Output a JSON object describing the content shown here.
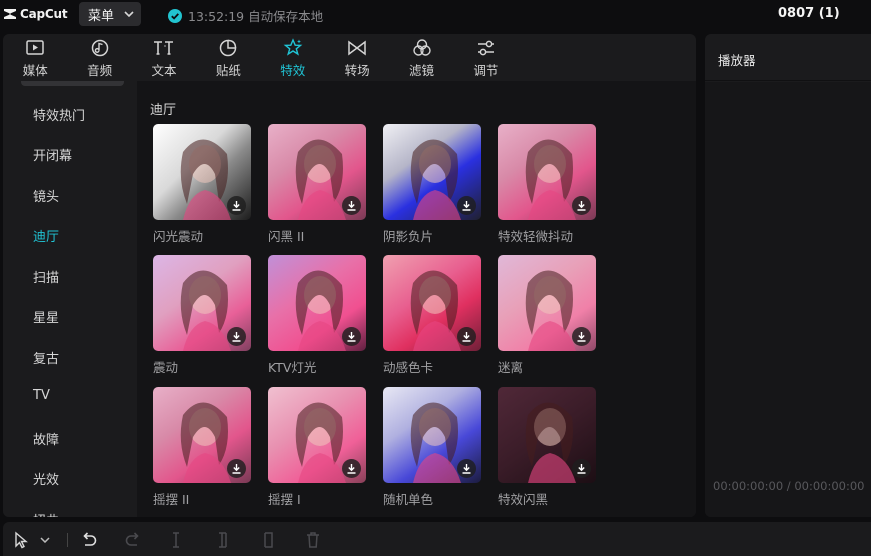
{
  "app": {
    "logo_text": "CapCut",
    "brand_color": "#20c4d5"
  },
  "header": {
    "menu_label": "菜单",
    "autosave_text": "13:52:19 自动保存本地",
    "project_title": "0807 (1)"
  },
  "tabs": [
    {
      "label": "媒体",
      "icon": "media-icon"
    },
    {
      "label": "音频",
      "icon": "audio-icon"
    },
    {
      "label": "文本",
      "icon": "text-icon"
    },
    {
      "label": "贴纸",
      "icon": "sticker-icon"
    },
    {
      "label": "特效",
      "icon": "effects-icon",
      "active": true
    },
    {
      "label": "转场",
      "icon": "transition-icon"
    },
    {
      "label": "滤镜",
      "icon": "filter-icon"
    },
    {
      "label": "调节",
      "icon": "adjust-icon"
    }
  ],
  "sidebar": {
    "items": [
      {
        "label": "特效热门"
      },
      {
        "label": "开闭幕"
      },
      {
        "label": "镜头"
      },
      {
        "label": "迪厅",
        "active": true
      },
      {
        "label": "扫描"
      },
      {
        "label": "星星"
      },
      {
        "label": "复古"
      },
      {
        "label": "TV"
      },
      {
        "label": "故障"
      },
      {
        "label": "光效"
      },
      {
        "label": "扭曲"
      }
    ]
  },
  "content": {
    "section_title": "迪厅",
    "effects": [
      {
        "label": "闪光震动",
        "style": "bw-flash"
      },
      {
        "label": "闪黑 II",
        "style": "pink"
      },
      {
        "label": "阴影负片",
        "style": "blue-neg"
      },
      {
        "label": "特效轻微抖动",
        "style": "pink"
      },
      {
        "label": "震动",
        "style": "pink-soft"
      },
      {
        "label": "KTV灯光",
        "style": "pink-lights"
      },
      {
        "label": "动感色卡",
        "style": "pink-red"
      },
      {
        "label": "迷离",
        "style": "pink-blur"
      },
      {
        "label": "摇摆 II",
        "style": "pink"
      },
      {
        "label": "摇摆 I",
        "style": "pink-motion"
      },
      {
        "label": "随机单色",
        "style": "blue-mono"
      },
      {
        "label": "特效闪黑",
        "style": "dark"
      }
    ]
  },
  "player": {
    "title": "播放器",
    "timecode": "00:00:00:00 / 00:00:00:00"
  },
  "toolbar": {
    "icons": [
      "select-pointer-icon",
      "chevron-down-icon",
      "undo-icon",
      "redo-icon",
      "split-icon",
      "split-left-icon",
      "split-right-icon",
      "delete-icon"
    ]
  }
}
